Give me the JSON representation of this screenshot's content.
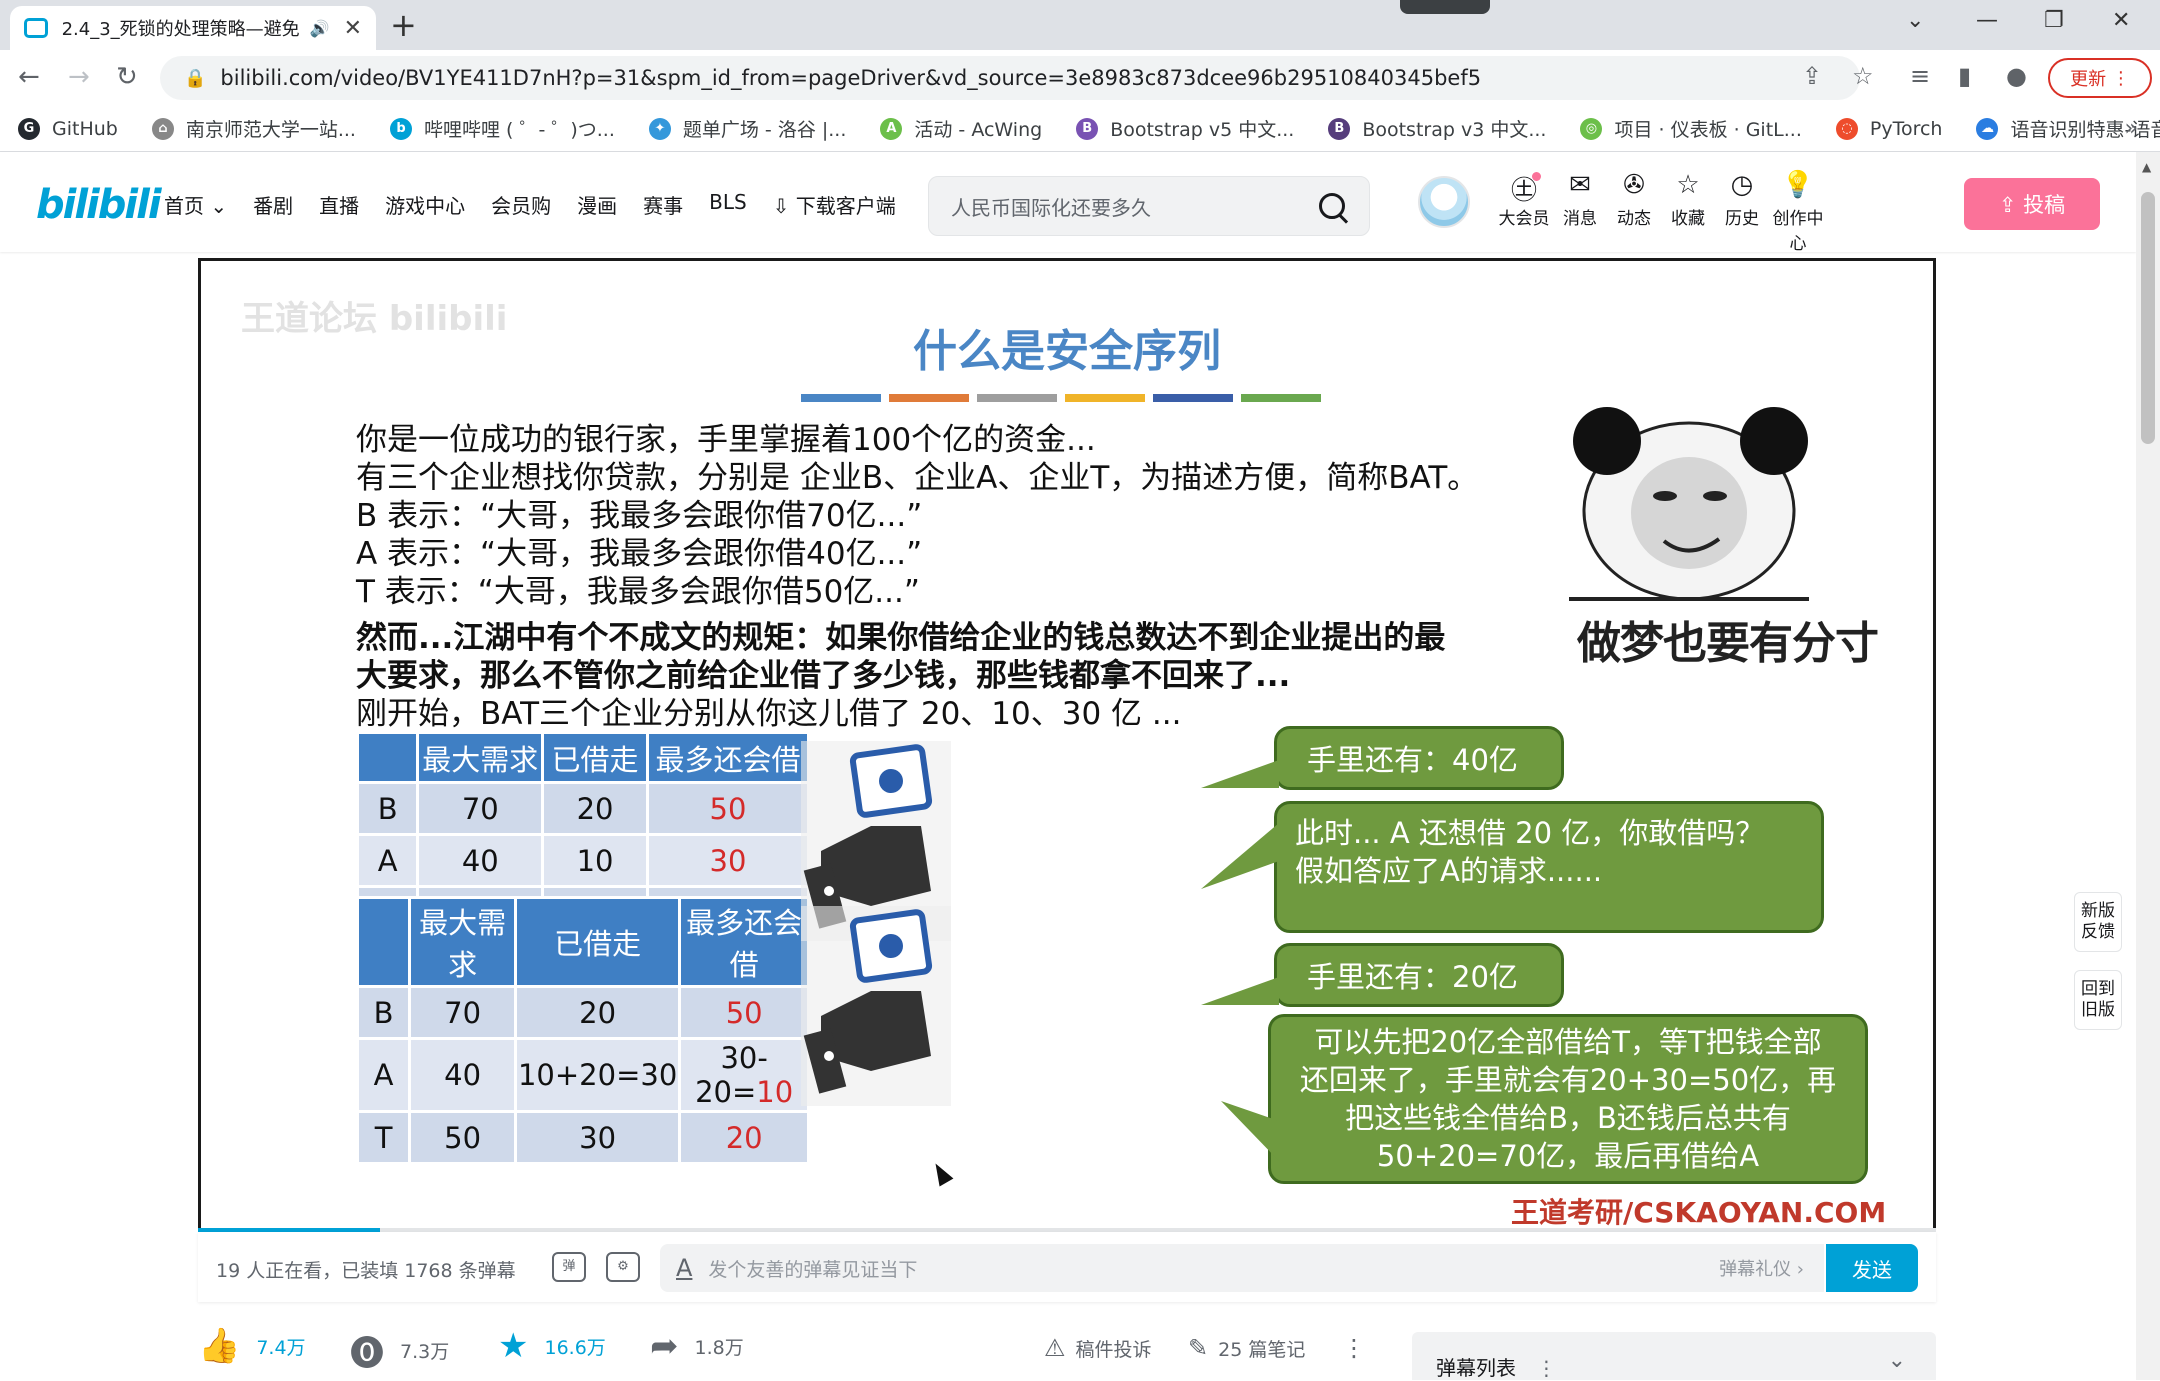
{
  "browser": {
    "tab_title": "2.4_3_死锁的处理策略—避免",
    "url": "bilibili.com/video/BV1YE411D7nH?p=31&spm_id_from=pageDriver&vd_source=3e8983c873dcee96b29510840345bef5",
    "update_label": "更新",
    "bookmarks": [
      {
        "label": "GitHub",
        "color": "#24292f",
        "glyph": "G"
      },
      {
        "label": "南京师范大学一站...",
        "color": "#888888",
        "glyph": "⌂"
      },
      {
        "label": "哔哩哔哩 ( ゜- ゜)つ...",
        "color": "#00a1d6",
        "glyph": "b"
      },
      {
        "label": "题单广场 - 洛谷 |...",
        "color": "#3498db",
        "glyph": "✦"
      },
      {
        "label": "活动 - AcWing",
        "color": "#6cbf4a",
        "glyph": "A"
      },
      {
        "label": "Bootstrap v5 中文...",
        "color": "#7952b3",
        "glyph": "B"
      },
      {
        "label": "Bootstrap v3 中文...",
        "color": "#563d7c",
        "glyph": "B"
      },
      {
        "label": "项目 · 仪表板 · GitL...",
        "color": "#6cbf4a",
        "glyph": "◎"
      },
      {
        "label": "PyTorch",
        "color": "#ee4c2c",
        "glyph": "◌"
      },
      {
        "label": "语音识别特惠-语音...",
        "color": "#2a7de1",
        "glyph": "☁"
      }
    ],
    "more_bookmarks": "»"
  },
  "header": {
    "logo": "bilibili",
    "nav": [
      "首页 ⌄",
      "番剧",
      "直播",
      "游戏中心",
      "会员购",
      "漫画",
      "赛事",
      "BLS",
      "⇩ 下载客户端"
    ],
    "search_placeholder": "人民币国际化还要多久",
    "icons": [
      {
        "label": "大会员",
        "glyph": "㊏"
      },
      {
        "label": "消息",
        "glyph": "✉"
      },
      {
        "label": "动态",
        "glyph": "✇"
      },
      {
        "label": "收藏",
        "glyph": "☆"
      },
      {
        "label": "历史",
        "glyph": "◷"
      },
      {
        "label": "创作中心",
        "glyph": "💡"
      }
    ],
    "upload_label": "⇪ 投稿"
  },
  "slide": {
    "watermark": "王道论坛 bilibili",
    "title": "什么是安全序列",
    "colors": [
      "#4a86c5",
      "#e07b39",
      "#9e9e9e",
      "#f0b429",
      "#3a5ea8",
      "#6aa84f"
    ],
    "paragraphs": [
      "你是一位成功的银行家，手里掌握着100个亿的资金...",
      "有三个企业想找你贷款，分别是 企业B、企业A、企业T，为描述方便，简称BAT。",
      "B 表示：“大哥，我最多会跟你借70亿...”",
      "A 表示：“大哥，我最多会跟你借40亿...”",
      "T 表示：“大哥，我最多会跟你借50亿...”",
      "然而...江湖中有个不成文的规矩：如果你借给企业的钱总数达不到企业提出的最",
      "大要求，那么不管你之前给企业借了多少钱，那些钱都拿不回来了...",
      "刚开始，BAT三个企业分别从你这儿借了 20、10、30 亿 ..."
    ],
    "meme_caption": "做梦也要有分寸",
    "table_headers": [
      "",
      "最大需求",
      "已借走",
      "最多还会借"
    ],
    "table1": [
      [
        "B",
        "70",
        "20",
        "50"
      ],
      [
        "A",
        "40",
        "10",
        "30"
      ],
      [
        "T",
        "50",
        "30",
        "20"
      ]
    ],
    "table2": [
      [
        "B",
        "70",
        "20",
        "",
        "50"
      ],
      [
        "A",
        "40",
        "10+20=30",
        "30-20=",
        "10"
      ],
      [
        "T",
        "50",
        "30",
        "",
        "20"
      ]
    ],
    "bubble1_small": "手里还有：40亿",
    "bubble1_big_line1": "此时... A 还想借 20 亿，你敢借吗？",
    "bubble1_big_line2": "假如答应了A的请求......",
    "bubble2_small": "手里还有：20亿",
    "bubble2_big_line1": "可以先把20亿全部借给T，等T把钱全部",
    "bubble2_big_line2": "还回来了，手里就会有20+30=50亿，再",
    "bubble2_big_line3": "把这些钱全借给B，B还钱后总共有",
    "bubble2_big_line4": "50+20=70亿，最后再借给A",
    "brand": "王道考研/CSKAOYAN.COM"
  },
  "player": {
    "progress": 0.105,
    "viewer_info": "19 人正在看，已装填 1768 条弹幕",
    "danmaku_placeholder": "发个友善的弹幕见证当下",
    "etiquette": "弹幕礼仪 ›",
    "send_label": "发送"
  },
  "actions": {
    "like": "7.4万",
    "coin": "7.3万",
    "favorite": "16.6万",
    "share": "1.8万",
    "report": "稿件投诉",
    "notes": "25 篇笔记",
    "danmaku_list": "弹幕列表"
  },
  "side": {
    "new_feedback": "新版 反馈",
    "back_old": "回到 旧版"
  }
}
